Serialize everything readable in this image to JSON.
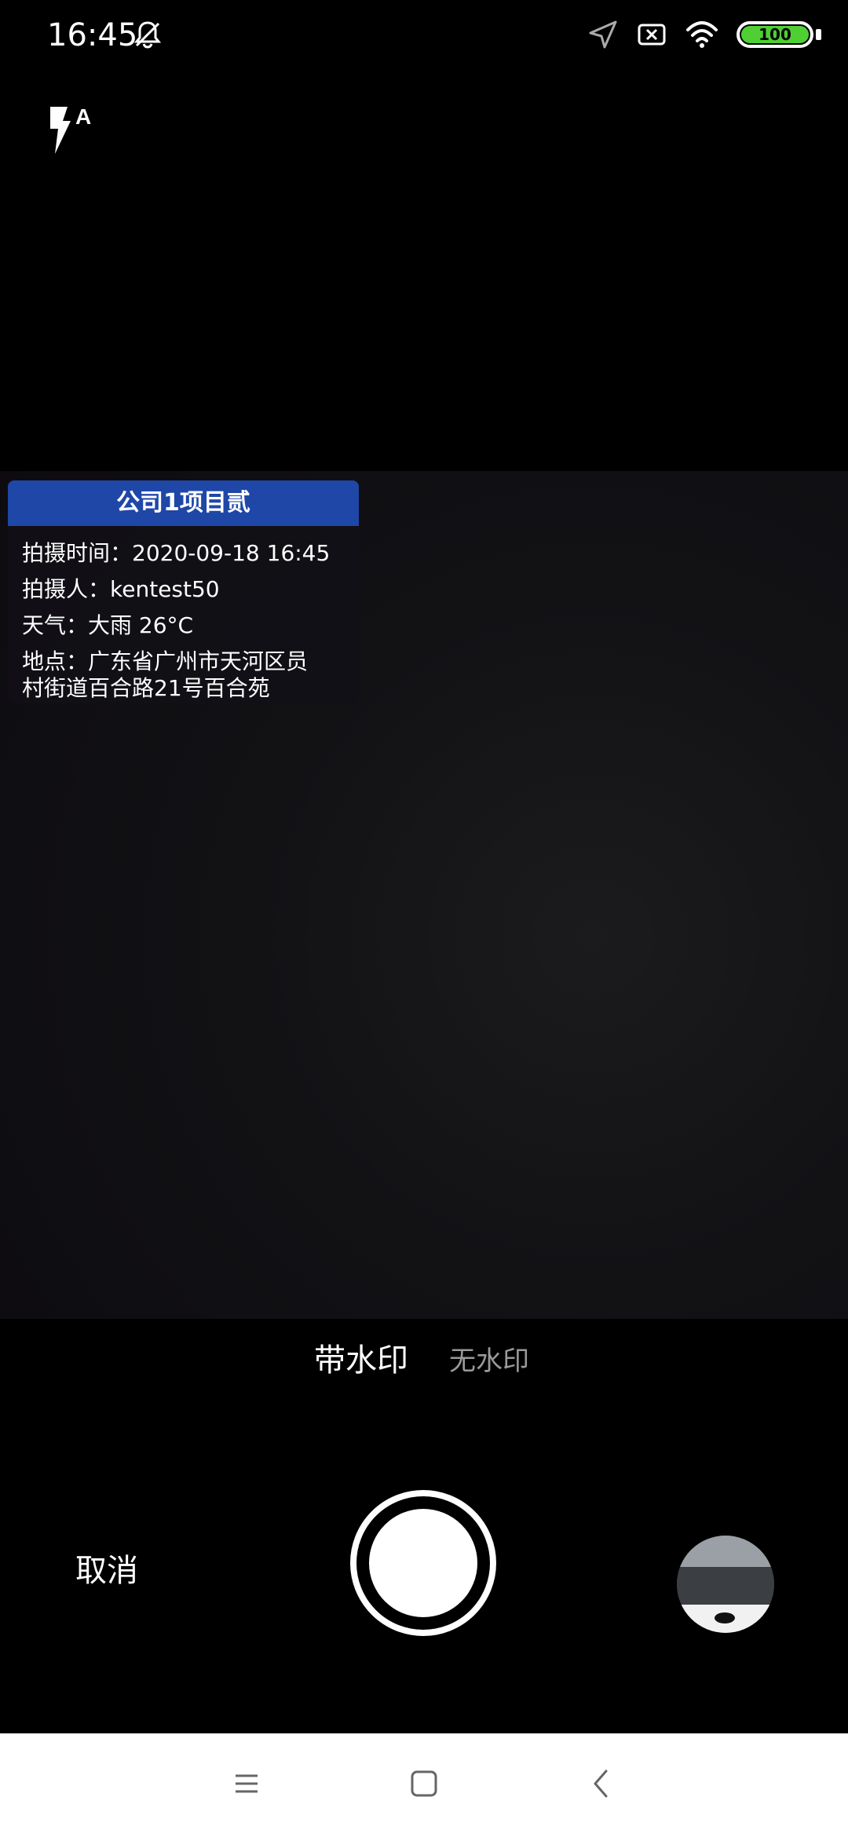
{
  "status": {
    "time": "16:45",
    "battery": "100"
  },
  "watermark": {
    "title": "公司1项目贰",
    "shoot_time": "拍摄时间：2020-09-18 16:45",
    "photographer": "拍摄人：kentest50",
    "weather": "天气：大雨 26°C",
    "address_line1": "地点：广东省广州市天河区员",
    "address_line2": "村街道百合路21号百合苑"
  },
  "modes": {
    "with_watermark": "带水印",
    "no_watermark": "无水印"
  },
  "controls": {
    "cancel": "取消"
  },
  "icons": {
    "flash": "flash-auto-icon",
    "bell": "bell-muted-icon",
    "location": "location-arrow-icon",
    "sim": "no-sim-icon",
    "wifi": "wifi-icon",
    "menu": "menu-icon",
    "home": "home-icon",
    "back": "back-icon"
  },
  "colors": {
    "watermark_header": "#1f47a8",
    "battery_fill": "#4fcf33"
  }
}
